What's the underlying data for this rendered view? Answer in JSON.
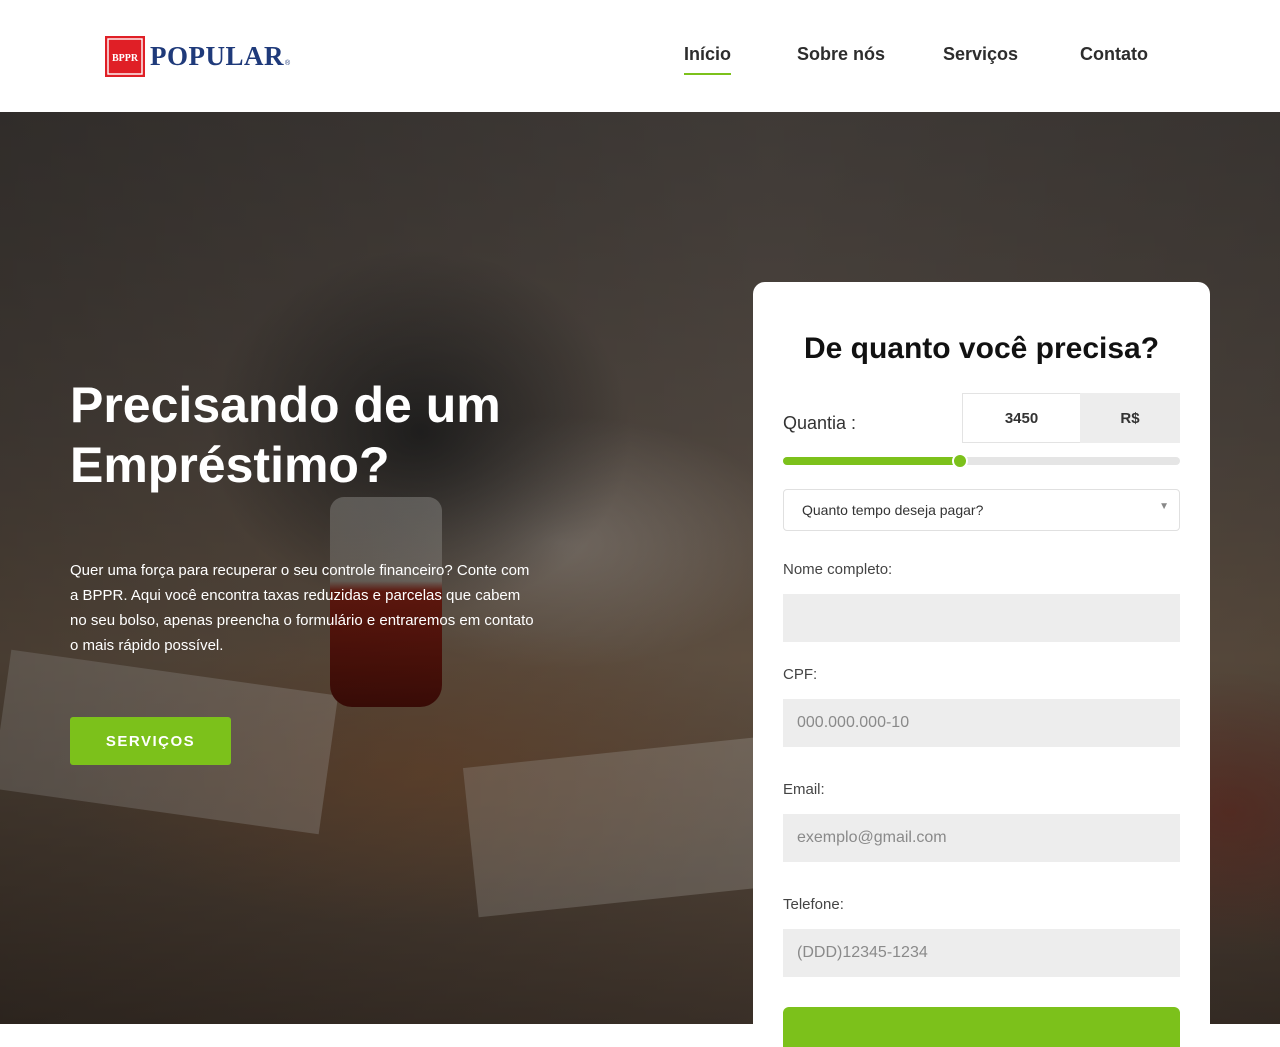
{
  "brand": {
    "name": "POPULAR",
    "mark_text": "BPPR",
    "registered": "®",
    "primary_color": "#1f3a7a",
    "mark_color": "#e01f26"
  },
  "nav": {
    "items": [
      {
        "label": "Início",
        "active": true
      },
      {
        "label": "Sobre nós",
        "active": false
      },
      {
        "label": "Serviços",
        "active": false
      },
      {
        "label": "Contato",
        "active": false
      }
    ],
    "accent_color": "#7cc11b"
  },
  "hero": {
    "title": "Precisando de um Empréstimo?",
    "text": "Quer uma força para recuperar o seu controle financeiro? Conte com a BPPR. Aqui você encontra taxas reduzidas e parcelas que cabem no seu bolso, apenas preencha o formulário e entraremos em contato o mais rápido possível.",
    "button_label": "SERVIÇOS"
  },
  "form": {
    "title": "De quanto você precisa?",
    "amount_label": "Quantia :",
    "amount_value": "3450",
    "currency": "R$",
    "slider_fraction": 0.44,
    "select_value": "Quanto tempo deseja pagar?",
    "fields": {
      "name": {
        "label": "Nome completo:",
        "placeholder": ""
      },
      "cpf": {
        "label": "CPF:",
        "placeholder": "000.000.000-10"
      },
      "email": {
        "label": "Email:",
        "placeholder": "exemplo@gmail.com"
      },
      "phone": {
        "label": "Telefone:",
        "placeholder": "(DDD)12345-1234"
      }
    }
  }
}
